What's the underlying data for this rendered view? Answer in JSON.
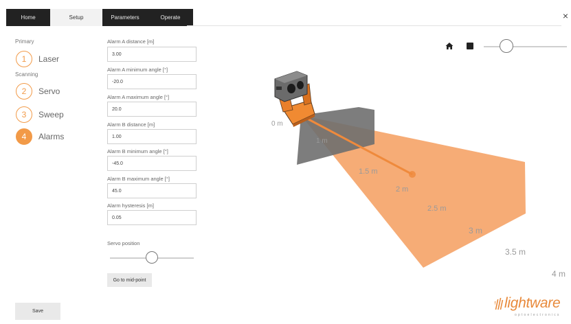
{
  "tabs": [
    {
      "label": "Home"
    },
    {
      "label": "Setup"
    },
    {
      "label": "Parameters"
    },
    {
      "label": "Operate"
    }
  ],
  "close_glyph": "×",
  "sections": {
    "primary": "Primary",
    "scanning": "Scanning"
  },
  "steps": [
    {
      "number": "1",
      "label": "Laser"
    },
    {
      "number": "2",
      "label": "Servo"
    },
    {
      "number": "3",
      "label": "Sweep"
    },
    {
      "number": "4",
      "label": "Alarms"
    }
  ],
  "fields": [
    {
      "label": "Alarm A distance [m]",
      "value": "3.00"
    },
    {
      "label": "Alarm A minimum angle [°]",
      "value": "-20.0"
    },
    {
      "label": "Alarm A maximum angle [°]",
      "value": "20.0"
    },
    {
      "label": "Alarm B distance [m]",
      "value": "1.00"
    },
    {
      "label": "Alarm B minimum angle [°]",
      "value": "-45.0"
    },
    {
      "label": "Alarm B maximum angle [°]",
      "value": "45.0"
    },
    {
      "label": "Alarm hysteresis [m]",
      "value": "0.05"
    }
  ],
  "servo": {
    "label": "Servo position",
    "position_fraction": 0.5
  },
  "buttons": {
    "midpoint": "Go to mid-point",
    "save": "Save"
  },
  "view": {
    "zoom_fraction": 0.27
  },
  "distances": [
    "0 m",
    "1 m",
    "1.5 m",
    "2 m",
    "2.5 m",
    "3 m",
    "3.5 m",
    "4 m"
  ],
  "logo": {
    "word": "lightware",
    "sub": "optoelectronics"
  },
  "icons": {
    "home": "home-icon",
    "stop": "square-icon",
    "close": "close-icon",
    "logo": "logo-bars-icon"
  },
  "colors": {
    "accent": "#f29a48",
    "alarm_a": "#f5a56a",
    "alarm_b": "#7a7a7a",
    "tab_dark": "#222222"
  }
}
